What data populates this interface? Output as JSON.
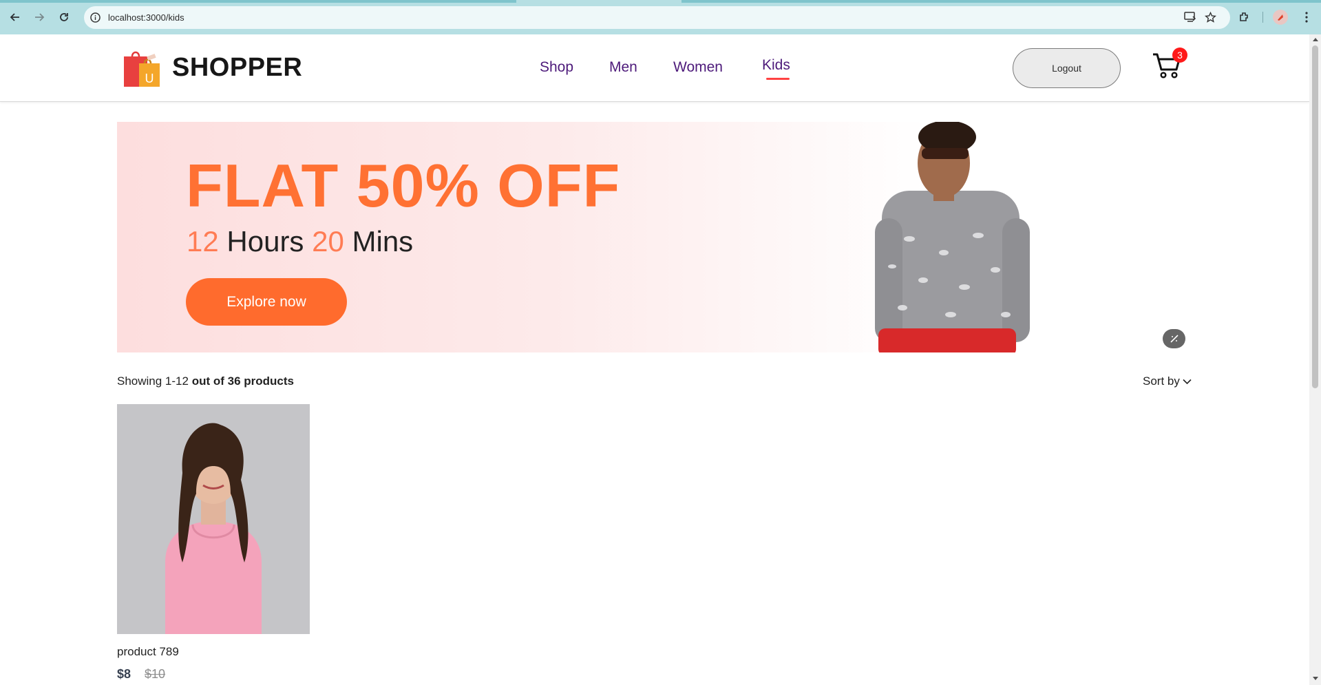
{
  "browser": {
    "url": "localhost:3000/kids",
    "accent": "#b6dfe3"
  },
  "navbar": {
    "logo_text": "SHOPPER",
    "logo_bag_letter": "U",
    "menu": [
      {
        "label": "Shop",
        "active": false
      },
      {
        "label": "Men",
        "active": false
      },
      {
        "label": "Women",
        "active": false
      },
      {
        "label": "Kids",
        "active": true
      }
    ],
    "logout_label": "Logout",
    "cart_count": "3"
  },
  "banner": {
    "title": "FLAT 50% OFF",
    "hours_value": "12",
    "hours_label": "Hours",
    "mins_value": "20",
    "mins_label": "Mins",
    "cta_label": "Explore now",
    "accent": "#ff6b2d"
  },
  "results": {
    "showing_prefix": "Showing 1-12",
    "showing_suffix": "out of 36 products",
    "sort_label": "Sort by"
  },
  "products": [
    {
      "name": "product 789",
      "new_price": "$8",
      "old_price": "$10"
    }
  ]
}
